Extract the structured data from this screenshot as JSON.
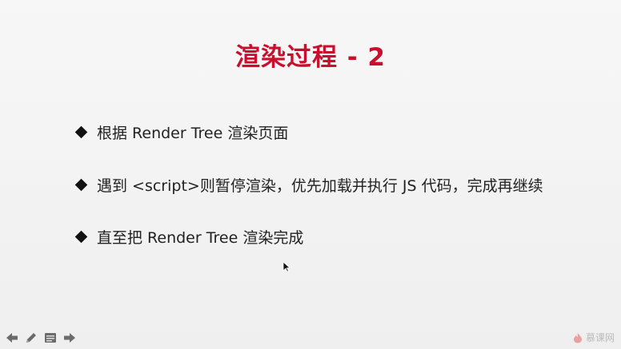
{
  "slide": {
    "title": "渲染过程 - 2",
    "bullets": [
      {
        "text": "根据 Render Tree 渲染页面"
      },
      {
        "text": "遇到 <script>则暂停渲染，优先加载并执行 JS 代码，完成再继续"
      },
      {
        "text": "直至把 Render Tree 渲染完成"
      }
    ]
  },
  "toolbar": {
    "icons": [
      "prev-arrow-icon",
      "pen-icon",
      "menu-icon",
      "next-arrow-icon"
    ]
  },
  "watermark": {
    "text": "慕课网"
  },
  "colors": {
    "title": "#c8102e",
    "text": "#222222",
    "background": "#f2f2f2"
  }
}
